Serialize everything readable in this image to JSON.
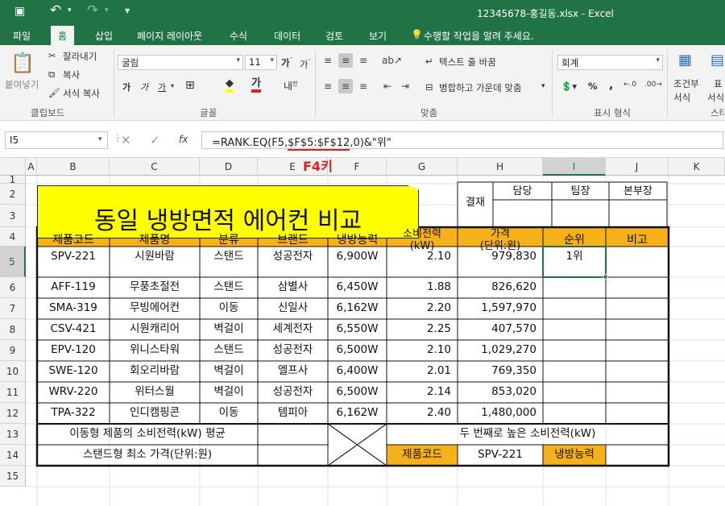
{
  "window": {
    "title": "12345678-홍길동.xlsx - Excel"
  },
  "quick_access": {
    "save": "H",
    "undo": "↶",
    "redo": "↷",
    "customize": "▾"
  },
  "tabs": [
    "파일",
    "홈",
    "삽입",
    "페이지 레이아웃",
    "수식",
    "데이터",
    "검토",
    "보기"
  ],
  "tell_me": "수행할 작업을 알려 주세요.",
  "ribbon": {
    "clipboard": {
      "paste": "붙여넣기",
      "cut": "잘라내기",
      "copy": "복사",
      "format_painter": "서식 복사",
      "group": "클립보드"
    },
    "font": {
      "name": "굴림",
      "size": "11",
      "bold": "가",
      "italic": "가",
      "underline": "가",
      "group": "글꼴"
    },
    "align": {
      "wrap": "텍스트 줄 바꿈",
      "merge": "병합하고 가운데 맞춤",
      "group": "맞춤"
    },
    "number": {
      "format": "회계",
      "group": "표시 형식"
    },
    "styles": {
      "cond": "조건부",
      "cond2": "서식",
      "fmt": "표",
      "fmt2": "서식",
      "group": "스타"
    }
  },
  "formula_bar": {
    "name_box": "I5",
    "cancel": "✕",
    "enter": "✓",
    "fx": "fx",
    "formula_pre": "=RANK.EQ(F5,",
    "formula_abs": "$F$5:$F$12",
    "formula_post": ",0)&\"위\""
  },
  "annotation": "F4키",
  "columns": [
    "A",
    "B",
    "C",
    "D",
    "E",
    "F",
    "G",
    "H",
    "I",
    "J",
    "K"
  ],
  "rows": [
    "1",
    "2",
    "3",
    "4",
    "5",
    "6",
    "7",
    "8",
    "9",
    "10",
    "11",
    "12",
    "13",
    "14",
    "15"
  ],
  "sheet": {
    "title": "동일 냉방면적 에어컨 비교",
    "approval": {
      "label": "결재",
      "cols": [
        "담당",
        "팀장",
        "본부장"
      ]
    },
    "headers": [
      "제품코드",
      "제품명",
      "분류",
      "브랜드",
      "냉방능력",
      "소비전력\n(kW)",
      "가격\n(단위:원)",
      "순위",
      "비고"
    ],
    "rows": [
      [
        "SPV-221",
        "시원바람",
        "스탠드",
        "성공전자",
        "6,900W",
        "2.10",
        "979,830",
        "1위",
        ""
      ],
      [
        "AFF-119",
        "무풍초절전",
        "스탠드",
        "삼별사",
        "6,450W",
        "1.88",
        "826,620",
        "",
        ""
      ],
      [
        "SMA-319",
        "무빙에어컨",
        "이동",
        "신일사",
        "6,162W",
        "2.20",
        "1,597,970",
        "",
        ""
      ],
      [
        "CSV-421",
        "시원캐리어",
        "벽걸이",
        "세계전자",
        "6,550W",
        "2.25",
        "407,570",
        "",
        ""
      ],
      [
        "EPV-120",
        "위니스타워",
        "스탠드",
        "성공전자",
        "6,500W",
        "2.10",
        "1,029,270",
        "",
        ""
      ],
      [
        "SWE-120",
        "회오리바람",
        "벽걸이",
        "엘프사",
        "6,400W",
        "2.01",
        "769,350",
        "",
        ""
      ],
      [
        "WRV-220",
        "위터스월",
        "벽걸이",
        "성공전자",
        "6,500W",
        "2.14",
        "853,020",
        "",
        ""
      ],
      [
        "TPA-322",
        "인디캠핑콘",
        "이동",
        "템피아",
        "6,162W",
        "2.40",
        "1,480,000",
        "",
        ""
      ]
    ],
    "summary": {
      "r13_left": "이동형 제품의 소비전력(kW) 평균",
      "r14_left": "스탠드형 최소 가격(단위:원)",
      "r13_right": "두 번째로 높은 소비전력(kW)",
      "r14_code_label": "제품코드",
      "r14_code_value": "SPV-221",
      "r14_power_label": "냉방능력"
    }
  },
  "colors": {
    "excel_green": "#217346",
    "header_fill": "#f5b01a",
    "title_fill": "#ffff00",
    "annotation_red": "#e02020"
  }
}
